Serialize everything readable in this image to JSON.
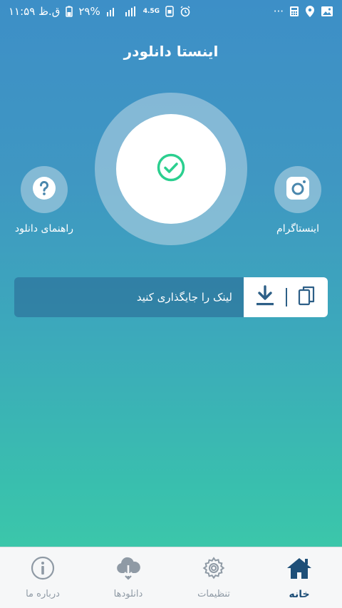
{
  "status_bar": {
    "time": "۱۱:۵۹ ق.ظ",
    "battery": "۲۹%",
    "network": "4.5G",
    "dots": "···"
  },
  "app": {
    "title": "اینستا دانلودر"
  },
  "center": {
    "icon": "check-circle-icon",
    "accent": "#2bcf8f"
  },
  "side_buttons": {
    "help_label": "راهنمای دانلود",
    "help_icon": "question-icon",
    "instagram_label": "اینستاگرام",
    "instagram_icon": "instagram-icon"
  },
  "link_bar": {
    "placeholder": "لینک را جایگذاری کنید",
    "download_icon": "download-icon",
    "paste_icon": "copy-icon"
  },
  "bottom_nav": {
    "items": [
      {
        "label": "درباره ما",
        "icon": "info-icon"
      },
      {
        "label": "دانلودها",
        "icon": "cloud-download-icon"
      },
      {
        "label": "تنظیمات",
        "icon": "gear-icon"
      },
      {
        "label": "خانه",
        "icon": "home-icon",
        "active": true
      }
    ],
    "active_color": "#1e4f78",
    "inactive_color": "#8f9aa5"
  }
}
